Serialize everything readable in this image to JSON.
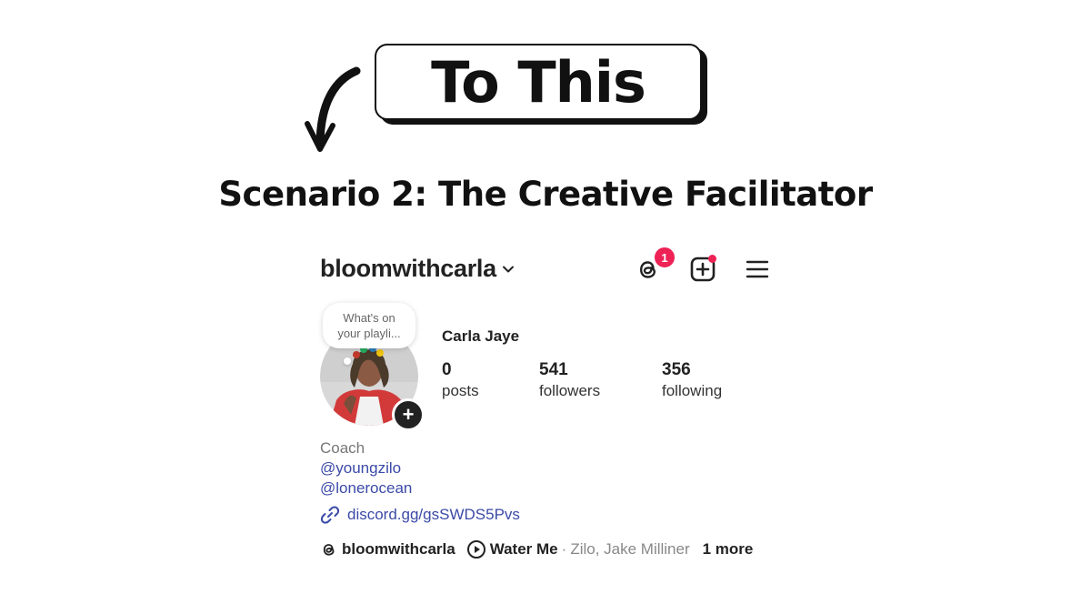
{
  "banner": {
    "label": "To This"
  },
  "heading": "Scenario 2: The Creative Facilitator",
  "profile": {
    "username": "bloomwithcarla",
    "threads_badge": "1",
    "note": {
      "line1": "What's on",
      "line2": "your playli..."
    },
    "display_name": "Carla Jaye",
    "stats": [
      {
        "value": "0",
        "label": "posts"
      },
      {
        "value": "541",
        "label": "followers"
      },
      {
        "value": "356",
        "label": "following"
      }
    ],
    "bio": {
      "category": "Coach",
      "mention1": "@youngzilo",
      "mention2": "@lonerocean"
    },
    "link": "discord.gg/gsSWDS5Pvs",
    "threads_handle": "bloomwithcarla",
    "music": {
      "title": "Water Me",
      "separator": "·",
      "artists": "Zilo, Jake Milliner",
      "more": "1 more"
    }
  },
  "colors": {
    "badge": "#ee2255",
    "link": "#3b4aa8",
    "text": "#222222"
  },
  "icons": [
    "curved-arrow-icon",
    "chevron-down-icon",
    "threads-icon",
    "new-post-icon",
    "menu-icon",
    "add-icon",
    "link-icon",
    "play-icon"
  ]
}
